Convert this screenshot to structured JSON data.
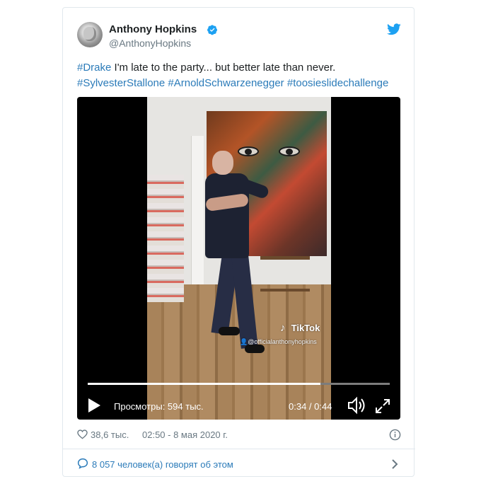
{
  "tweet": {
    "author": {
      "name": "Anthony Hopkins",
      "handle": "@AnthonyHopkins",
      "verified": true
    },
    "text": {
      "tag1": "#Drake",
      "body": " I'm late to the party... but better late than never.",
      "tag2": "#SylvesterStallone",
      "tag3": "#ArnoldSchwarzenegger",
      "tag4": "#toosieslidechallenge"
    },
    "video": {
      "watermark_brand": "TikTok",
      "watermark_user": "@officialanthonyhopkins",
      "views": "Просмотры: 594 тыс.",
      "time": "0:34 / 0:44",
      "progress": 0.77
    },
    "likes": "38,6 тыс.",
    "date": "02:50 - 8 мая 2020 г.",
    "footer_text": "8 057 человек(а) говорят об этом"
  },
  "colors": {
    "link": "#2b7bb9",
    "verified": "#1da1f2",
    "twitter_bird": "#1da1f2",
    "muted": "#697882"
  },
  "icons": [
    "verified-badge-icon",
    "twitter-bird-icon",
    "play-icon",
    "volume-icon",
    "fullscreen-icon",
    "heart-icon",
    "info-icon",
    "speech-bubble-icon",
    "chevron-right-icon",
    "tiktok-logo-icon",
    "user-icon"
  ]
}
